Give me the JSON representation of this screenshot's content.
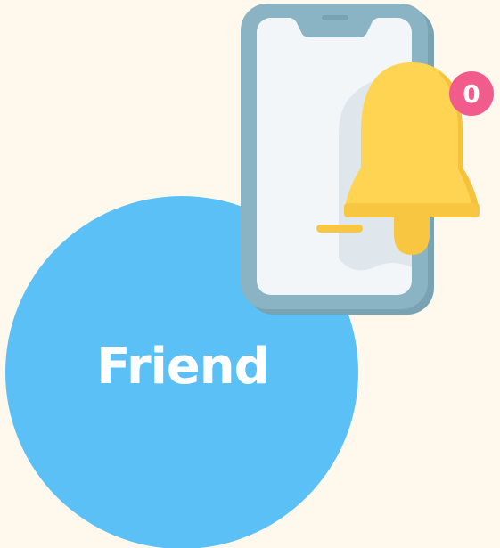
{
  "label": "Friend",
  "notification_count": "0",
  "icons": {
    "phone": "smartphone-icon",
    "bell": "bell-icon",
    "badge": "notification-badge"
  },
  "colors": {
    "background": "#fff8ec",
    "circle": "#5bc0f5",
    "label_text": "#ffffff",
    "phone_frame": "#8ab4c3",
    "phone_frame_shadow": "#79a3b3",
    "phone_screen": "#f2f6f8",
    "phone_screen_shade": "#dfe7ec",
    "phone_notch": "#8ab4c3",
    "bell_body": "#ffd452",
    "bell_shadow": "#f7c23b",
    "bell_band": "#f9c642",
    "badge": "#f15c8d",
    "badge_text": "#ffffff"
  }
}
